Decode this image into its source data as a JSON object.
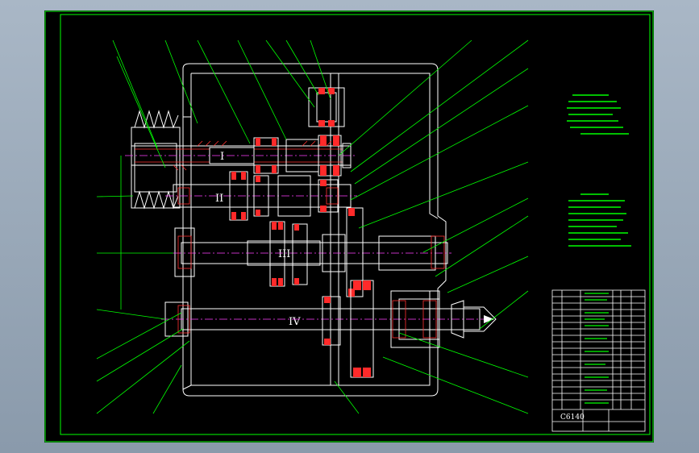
{
  "drawing": {
    "shaft_labels": [
      "I",
      "II",
      "III",
      "IV"
    ],
    "drawing_number": "C6140"
  },
  "colors": {
    "background": "#000000",
    "frame": "#00ff00",
    "outline": "#ffffff",
    "section": "#ff3030",
    "centerline": "#ff40ff",
    "leader": "#00ff00",
    "gear_red": "#ff2a2a"
  }
}
